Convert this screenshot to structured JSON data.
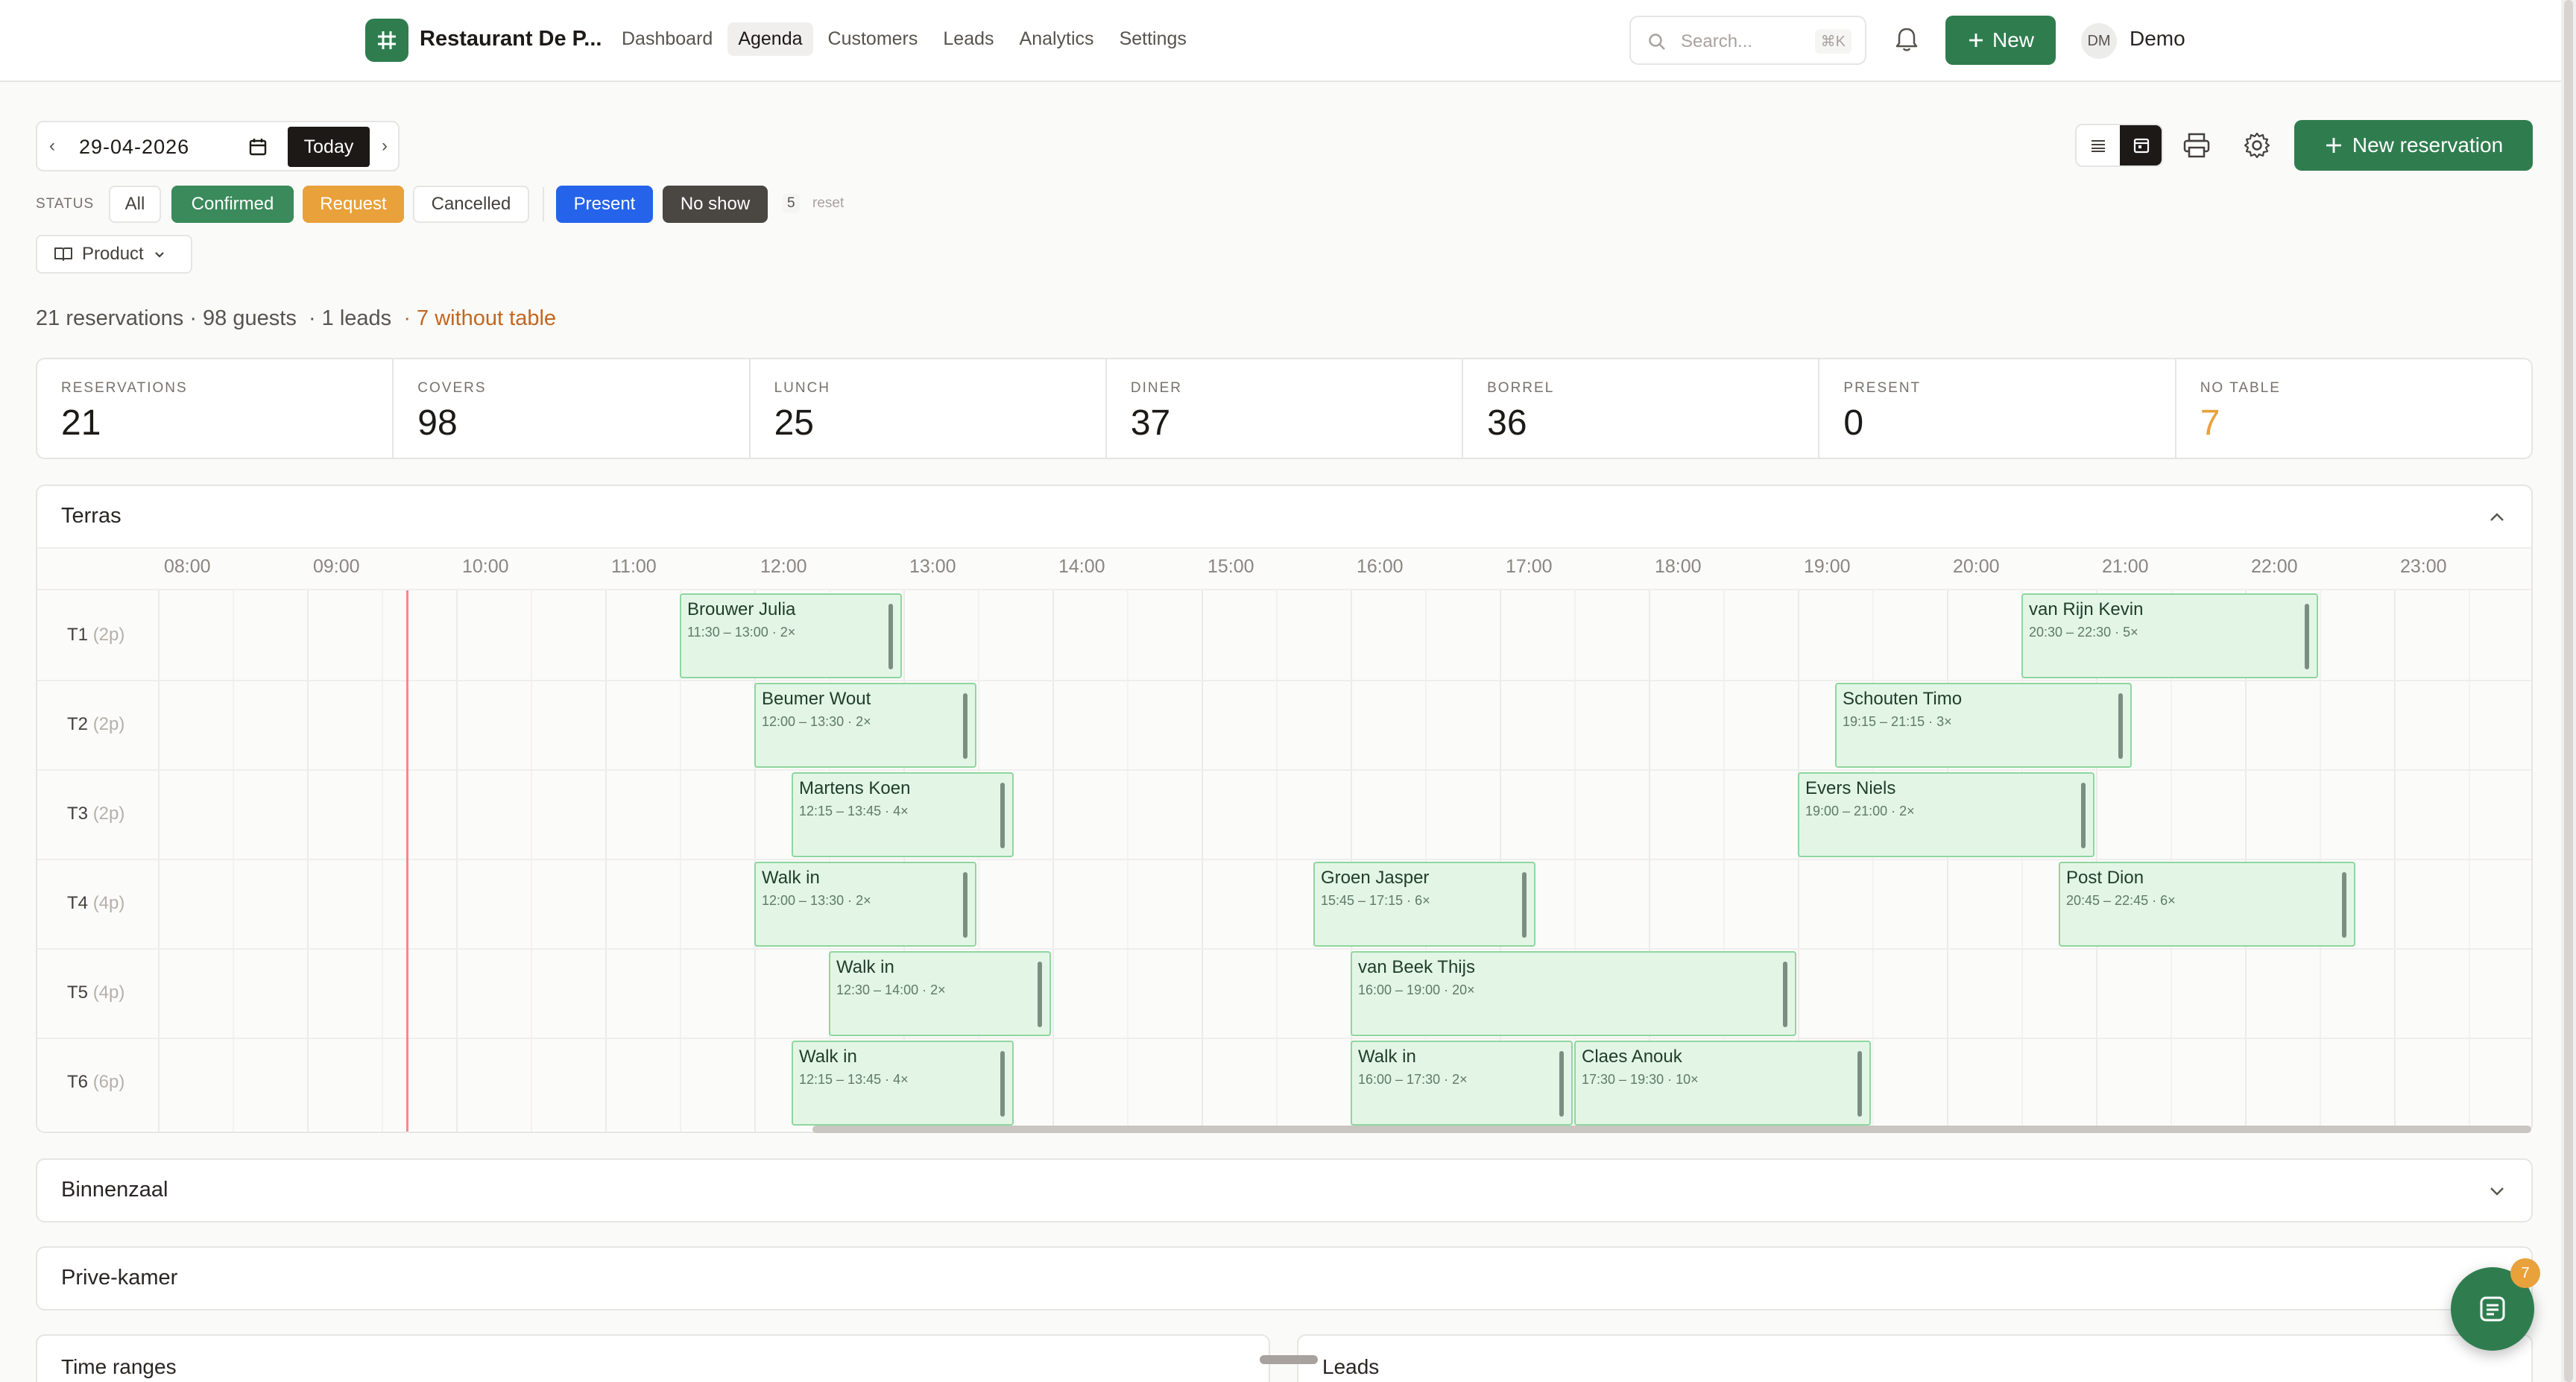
{
  "app": {
    "name": "Restaurant De P...",
    "logo_glyph": "#"
  },
  "nav": [
    {
      "label": "Dashboard",
      "active": false
    },
    {
      "label": "Agenda",
      "active": true
    },
    {
      "label": "Customers",
      "active": false
    },
    {
      "label": "Leads",
      "active": false
    },
    {
      "label": "Analytics",
      "active": false
    },
    {
      "label": "Settings",
      "active": false
    }
  ],
  "search": {
    "placeholder": "Search...",
    "shortcut": "⌘K"
  },
  "header": {
    "new_label": "New",
    "user_initials": "DM",
    "user_name": "Demo"
  },
  "toolbar": {
    "prev": "‹",
    "next": "›",
    "date": "29-04-2026",
    "today_label": "Today",
    "new_reservation_label": "New reservation"
  },
  "filters": {
    "status_label": "STATUS",
    "chips": [
      "All",
      "Confirmed",
      "Request",
      "Cancelled",
      "Present",
      "No show"
    ],
    "count": "5",
    "reset_label": "reset",
    "product_label": "Product"
  },
  "summary": {
    "reservations": "21 reservations",
    "guests": "· 98 guests",
    "leads": "· 1 leads",
    "without_table": "· 7 without table"
  },
  "stats": [
    {
      "label": "RESERVATIONS",
      "value": "21",
      "warn": false
    },
    {
      "label": "COVERS",
      "value": "98",
      "warn": false
    },
    {
      "label": "LUNCH",
      "value": "25",
      "warn": false
    },
    {
      "label": "DINER",
      "value": "37",
      "warn": false
    },
    {
      "label": "BORREL",
      "value": "36",
      "warn": false
    },
    {
      "label": "PRESENT",
      "value": "0",
      "warn": false
    },
    {
      "label": "NO TABLE",
      "value": "7",
      "warn": true
    }
  ],
  "terras": {
    "title": "Terras",
    "hours": [
      "08:00",
      "09:00",
      "10:00",
      "11:00",
      "12:00",
      "13:00",
      "14:00",
      "15:00",
      "16:00",
      "17:00",
      "18:00",
      "19:00",
      "20:00",
      "21:00",
      "22:00",
      "23:00"
    ],
    "now_time": "09:40",
    "tables": [
      {
        "name": "T1",
        "cap": "(2p)"
      },
      {
        "name": "T2",
        "cap": "(2p)"
      },
      {
        "name": "T3",
        "cap": "(2p)"
      },
      {
        "name": "T4",
        "cap": "(4p)"
      },
      {
        "name": "T5",
        "cap": "(4p)"
      },
      {
        "name": "T6",
        "cap": "(6p)"
      }
    ],
    "reservations": [
      {
        "table": 0,
        "name": "Brouwer Julia",
        "start": "11:30",
        "end": "13:00",
        "meta": "11:30 – 13:00 · 2×"
      },
      {
        "table": 0,
        "name": "van Rijn Kevin",
        "start": "20:30",
        "end": "22:30",
        "meta": "20:30 – 22:30 · 5×"
      },
      {
        "table": 1,
        "name": "Beumer Wout",
        "start": "12:00",
        "end": "13:30",
        "meta": "12:00 – 13:30 · 2×"
      },
      {
        "table": 1,
        "name": "Schouten Timo",
        "start": "19:15",
        "end": "21:15",
        "meta": "19:15 – 21:15 · 3×"
      },
      {
        "table": 2,
        "name": "Martens Koen",
        "start": "12:15",
        "end": "13:45",
        "meta": "12:15 – 13:45 · 4×"
      },
      {
        "table": 2,
        "name": "Evers Niels",
        "start": "19:00",
        "end": "21:00",
        "meta": "19:00 – 21:00 · 2×"
      },
      {
        "table": 3,
        "name": "Walk in",
        "start": "12:00",
        "end": "13:30",
        "meta": "12:00 – 13:30 · 2×"
      },
      {
        "table": 3,
        "name": "Groen Jasper",
        "start": "15:45",
        "end": "17:15",
        "meta": "15:45 – 17:15 · 6×"
      },
      {
        "table": 3,
        "name": "Post Dion",
        "start": "20:45",
        "end": "22:45",
        "meta": "20:45 – 22:45 · 6×"
      },
      {
        "table": 4,
        "name": "Walk in",
        "start": "12:30",
        "end": "14:00",
        "meta": "12:30 – 14:00 · 2×"
      },
      {
        "table": 4,
        "name": "van Beek Thijs",
        "start": "16:00",
        "end": "19:00",
        "meta": "16:00 – 19:00 · 20×"
      },
      {
        "table": 5,
        "name": "Walk in",
        "start": "12:15",
        "end": "13:45",
        "meta": "12:15 – 13:45 · 4×"
      },
      {
        "table": 5,
        "name": "Walk in",
        "start": "16:00",
        "end": "17:30",
        "meta": "16:00 – 17:30 · 2×"
      },
      {
        "table": 5,
        "name": "Claes Anouk",
        "start": "17:30",
        "end": "19:30",
        "meta": "17:30 – 19:30 · 10×"
      }
    ]
  },
  "sections": {
    "binnenzaal": "Binnenzaal",
    "privekamer": "Prive-kamer"
  },
  "panels": {
    "time_ranges": "Time ranges",
    "leads": "Leads"
  },
  "fab": {
    "badge": "7"
  },
  "colors": {
    "brand": "#2f7d4f",
    "request": "#e9a13b",
    "present": "#2563eb",
    "no_show": "#4a4642",
    "warn_text": "#c2661f",
    "reservation_fill": "#e3f6e6",
    "reservation_border": "#8fd69e",
    "now_line": "#f28a8a"
  }
}
